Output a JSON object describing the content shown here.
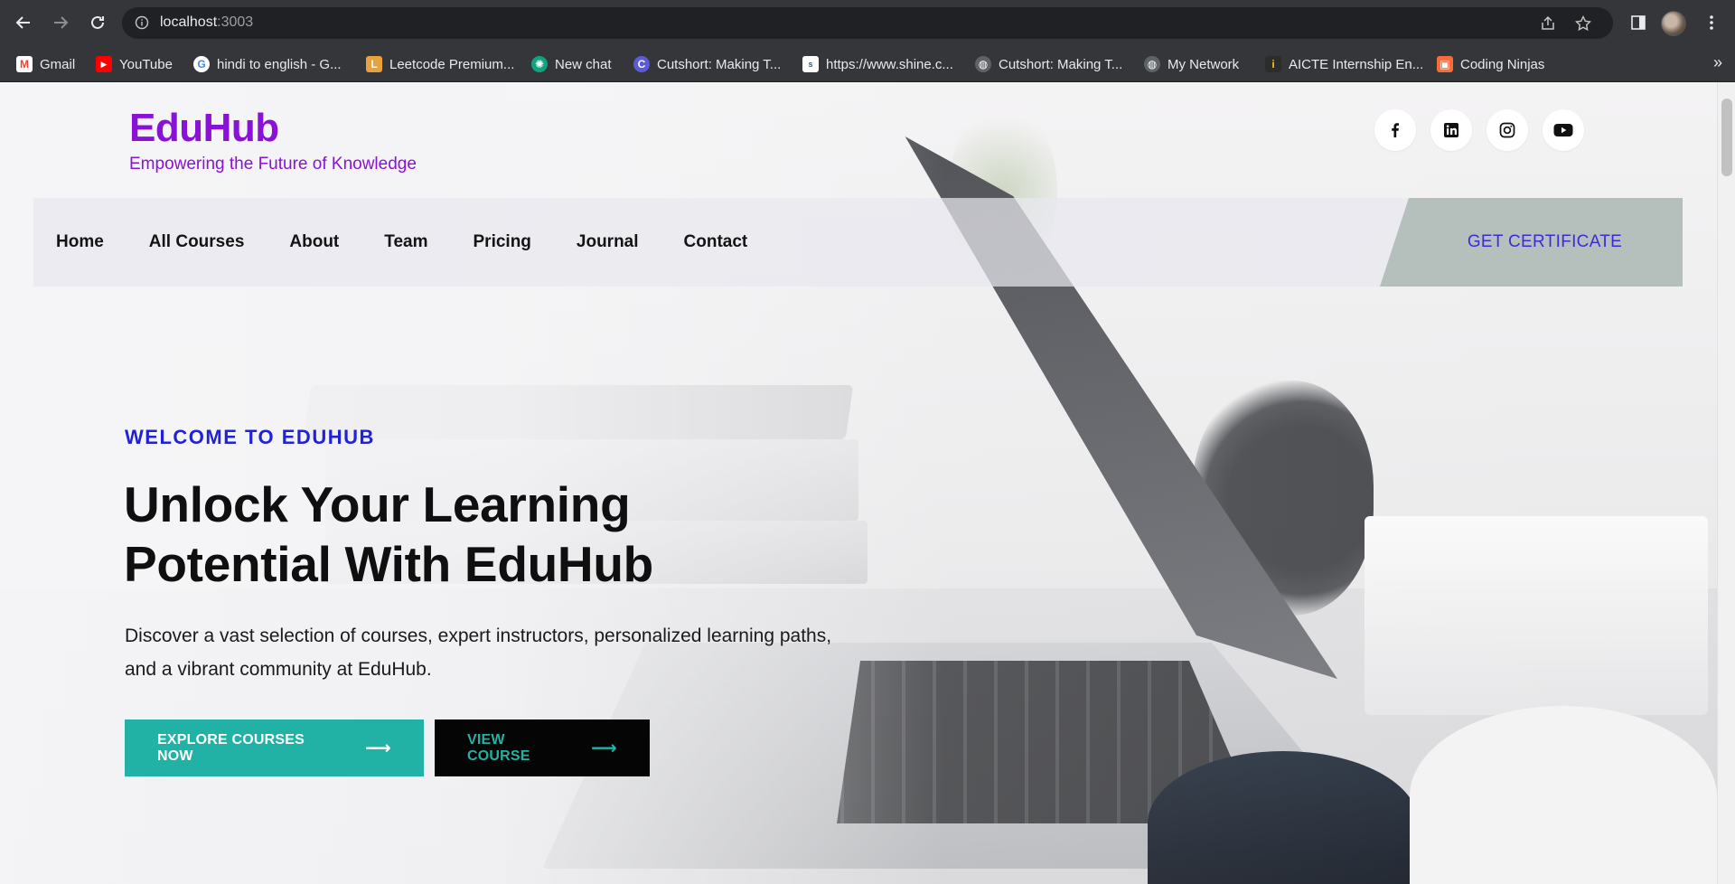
{
  "browser": {
    "url_host": "localhost",
    "url_port": ":3003",
    "bookmarks": [
      {
        "label": "Gmail",
        "icon": "gmail-icon",
        "color": "#ea4335",
        "glyph": "M"
      },
      {
        "label": "YouTube",
        "icon": "youtube-icon",
        "color": "#ff0000",
        "glyph": "▶"
      },
      {
        "label": "hindi to english - G...",
        "icon": "google-icon",
        "color": "#4285f4",
        "glyph": "G"
      },
      {
        "label": "Leetcode Premium...",
        "icon": "leetcode-icon",
        "color": "#e9a23b",
        "glyph": "L"
      },
      {
        "label": "New chat",
        "icon": "chatgpt-icon",
        "color": "#10a37f",
        "glyph": "✺"
      },
      {
        "label": "Cutshort: Making T...",
        "icon": "cutshort-icon",
        "color": "#5b5bd6",
        "glyph": "C"
      },
      {
        "label": "https://www.shine.c...",
        "icon": "shine-icon",
        "color": "#2255aa",
        "glyph": "s"
      },
      {
        "label": "Cutshort: Making T...",
        "icon": "globe-icon",
        "color": "#5f6368",
        "glyph": "◍"
      },
      {
        "label": "My Network",
        "icon": "globe-icon",
        "color": "#5f6368",
        "glyph": "◍"
      },
      {
        "label": "AICTE Internship En...",
        "icon": "aicte-icon",
        "color": "#2c2c2c",
        "glyph": "i"
      },
      {
        "label": "Coding Ninjas",
        "icon": "codingninjas-icon",
        "color": "#f66c3b",
        "glyph": "▣"
      }
    ],
    "more_label": "»"
  },
  "site": {
    "brand": "EduHub",
    "tagline": "Empowering the Future of Knowledge",
    "brand_color": "#8a12d6",
    "social": [
      "facebook-icon",
      "linkedin-icon",
      "instagram-icon",
      "youtube-icon"
    ],
    "nav": [
      "Home",
      "All Courses",
      "About",
      "Team",
      "Pricing",
      "Journal",
      "Contact"
    ],
    "cta": "GET CERTIFICATE"
  },
  "hero": {
    "eyebrow": "WELCOME TO EDUHUB",
    "headline_line1": "Unlock Your Learning",
    "headline_line2": "Potential With EduHub",
    "lead": "Discover a vast selection of courses, expert instructors, personalized learning paths, and a vibrant community at EduHub.",
    "primary_button": "EXPLORE COURSES NOW",
    "secondary_button": "VIEW COURSE",
    "arrow": "⟶",
    "accent_color": "#22b2a5",
    "eyebrow_color": "#1f23d4"
  }
}
